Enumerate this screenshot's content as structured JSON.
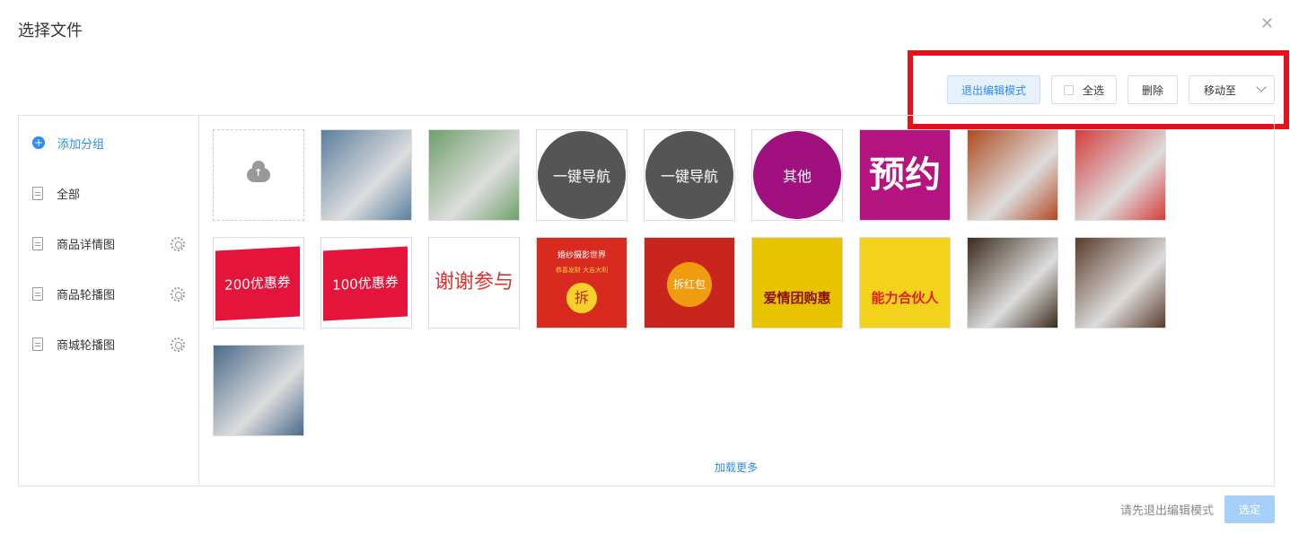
{
  "dialog": {
    "title": "选择文件",
    "close_icon": "close-icon"
  },
  "toolbar": {
    "exit_edit_label": "退出编辑模式",
    "select_all_label": "全选",
    "delete_label": "删除",
    "move_to_label": "移动至"
  },
  "sidebar": {
    "add_group_label": "添加分组",
    "items": [
      {
        "label": "全部"
      },
      {
        "label": "商品详情图"
      },
      {
        "label": "商品轮播图"
      },
      {
        "label": "商城轮播图"
      }
    ]
  },
  "tiles": [
    {
      "kind": "upload"
    },
    {
      "kind": "photo",
      "desc_color": "#5a7fa0"
    },
    {
      "kind": "photo",
      "desc_color": "#6fa06a"
    },
    {
      "kind": "circle",
      "text": "一键导航",
      "color": "#555"
    },
    {
      "kind": "circle",
      "text": "一键导航",
      "color": "#555"
    },
    {
      "kind": "circle",
      "text": "其他",
      "color": "#a0107e"
    },
    {
      "kind": "block",
      "text": "预约",
      "color": "#b5137f"
    },
    {
      "kind": "photo",
      "desc_color": "#b04a20"
    },
    {
      "kind": "photo",
      "desc_color": "#d53c3c"
    },
    {
      "kind": "banner",
      "text": "200优惠券",
      "color": "#e5143a"
    },
    {
      "kind": "banner",
      "text": "100优惠券",
      "color": "#e5143a"
    },
    {
      "kind": "text",
      "text": "谢谢参与",
      "color": "#e03030"
    },
    {
      "kind": "envelope",
      "top": "婚纱摄影世界",
      "sub": "恭喜发财 大吉大利",
      "badge": "拆",
      "color": "#d82a1e"
    },
    {
      "kind": "envelope2",
      "badge": "拆红包",
      "color": "#c9251f"
    },
    {
      "kind": "poster",
      "text": "爱情团购惠",
      "color": "#e8c400"
    },
    {
      "kind": "poster2",
      "text": "能力合伙人",
      "color": "#f2d21a"
    },
    {
      "kind": "photo",
      "desc_color": "#3a2a1a"
    },
    {
      "kind": "photo",
      "desc_color": "#5a3a2a"
    },
    {
      "kind": "photo",
      "desc_color": "#4a6a8a"
    }
  ],
  "footer": {
    "load_more": "加载更多",
    "hint": "请先退出编辑模式",
    "confirm": "选定"
  }
}
